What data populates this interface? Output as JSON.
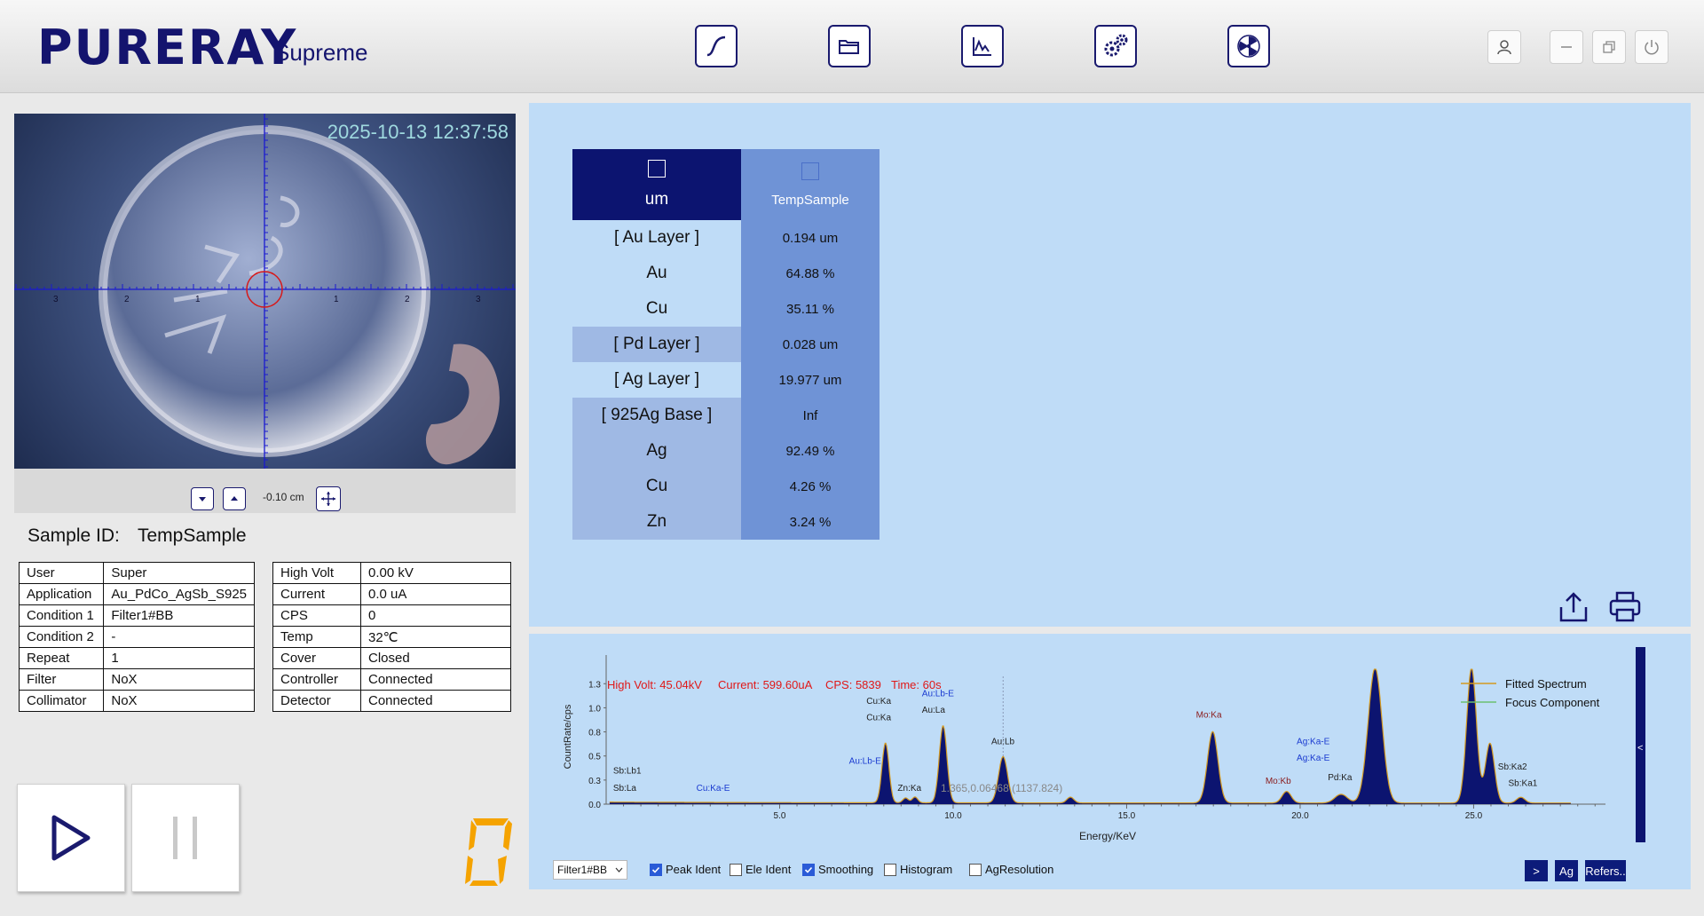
{
  "header": {
    "logo": "PURERAY",
    "logo_sub": "Supreme",
    "toolbar": [
      {
        "name": "curve-tool-button",
        "icon": "curve-icon"
      },
      {
        "name": "open-folder-button",
        "icon": "folder-icon"
      },
      {
        "name": "spectrum-button",
        "icon": "chart-icon"
      },
      {
        "name": "settings-button",
        "icon": "gears-icon"
      },
      {
        "name": "radiation-button",
        "icon": "radiation-icon"
      }
    ]
  },
  "camera": {
    "timestamp": "2025-10-13 12:37:58",
    "scale": "-0.10 cm",
    "ruler_labels": [
      "3",
      "2",
      "1",
      "1",
      "2",
      "3"
    ]
  },
  "sample": {
    "label": "Sample ID:",
    "value": "TempSample"
  },
  "info_left": [
    [
      "User",
      "Super"
    ],
    [
      "Application",
      "Au_PdCo_AgSb_S925"
    ],
    [
      "Condition 1",
      "Filter1#BB"
    ],
    [
      "Condition 2",
      "-"
    ],
    [
      "Repeat",
      "1"
    ],
    [
      "Filter",
      "NoX"
    ],
    [
      "Collimator",
      "NoX"
    ]
  ],
  "info_right": [
    [
      "High Volt",
      "0.00 kV"
    ],
    [
      "Current",
      "0.0 uA"
    ],
    [
      "CPS",
      "0"
    ],
    [
      "Temp",
      "32℃"
    ],
    [
      "Cover",
      "Closed"
    ],
    [
      "Controller",
      "Connected"
    ],
    [
      "Detector",
      "Connected"
    ]
  ],
  "counter_digit": "0",
  "results": {
    "unit_header": "um",
    "sample_header": "TempSample",
    "rows": [
      [
        "[ Au Layer ]",
        "0.194 um"
      ],
      [
        "Au",
        "64.88 %"
      ],
      [
        "Cu",
        "35.11 %"
      ],
      [
        "[ Pd Layer ]",
        "0.028 um"
      ],
      [
        "[ Ag Layer ]",
        "19.977 um"
      ],
      [
        "[ 925Ag Base ]",
        "Inf"
      ],
      [
        "Ag",
        "92.49 %"
      ],
      [
        "Cu",
        "4.26 %"
      ],
      [
        "Zn",
        "3.24 %"
      ]
    ]
  },
  "spectrum": {
    "status": {
      "high_volt": "High Volt: 45.04kV",
      "current": "Current: 599.60uA",
      "cps": "CPS: 5839",
      "time": "Time: 60s"
    },
    "cursor_readout": "1.365,0.06468 (1137.824)",
    "legend": [
      "Fitted Spectrum",
      "Focus Component"
    ],
    "filter_select": "Filter1#BB",
    "options": [
      {
        "label": "Peak Ident",
        "checked": true
      },
      {
        "label": "Ele Ident",
        "checked": false
      },
      {
        "label": "Smoothing",
        "checked": true
      },
      {
        "label": "Histogram",
        "checked": false
      },
      {
        "label": "AgResolution",
        "checked": false
      }
    ],
    "buttons": [
      ">",
      "Ag",
      "Refers.."
    ],
    "side_tab": "<"
  },
  "chart_data": {
    "type": "line",
    "xlabel": "Energy/KeV",
    "ylabel": "CountRate/cps",
    "xlim": [
      0,
      28.8
    ],
    "ylim": [
      0,
      1.4
    ],
    "xticks": [
      "5.0",
      "10.0",
      "15.0",
      "20.0",
      "25.0"
    ],
    "xtick_values": [
      5,
      10,
      15,
      20,
      25
    ],
    "yticks": [
      "0.0",
      "0.3",
      "0.5",
      "0.8",
      "1.0",
      "1.3"
    ],
    "ytick_values": [
      0.0,
      0.25,
      0.5,
      0.75,
      1.0,
      1.25
    ],
    "peaks": [
      {
        "x": 8.05,
        "h": 0.62,
        "w": 0.1
      },
      {
        "x": 8.63,
        "h": 0.05,
        "w": 0.08
      },
      {
        "x": 8.9,
        "h": 0.06,
        "w": 0.08
      },
      {
        "x": 9.71,
        "h": 0.8,
        "w": 0.11
      },
      {
        "x": 11.44,
        "h": 0.48,
        "w": 0.13
      },
      {
        "x": 13.38,
        "h": 0.06,
        "w": 0.1
      },
      {
        "x": 17.48,
        "h": 0.74,
        "w": 0.15
      },
      {
        "x": 19.61,
        "h": 0.12,
        "w": 0.13
      },
      {
        "x": 21.18,
        "h": 0.09,
        "w": 0.18
      },
      {
        "x": 22.16,
        "h": 1.4,
        "w": 0.2
      },
      {
        "x": 24.94,
        "h": 1.4,
        "w": 0.14
      },
      {
        "x": 25.47,
        "h": 0.62,
        "w": 0.13
      },
      {
        "x": 26.36,
        "h": 0.06,
        "w": 0.12
      }
    ],
    "annotations": [
      {
        "text": "Sb:Lb1",
        "x": 0.2,
        "y": 0.32,
        "color": "#222"
      },
      {
        "text": "Sb:La",
        "x": 0.2,
        "y": 0.14,
        "color": "#222"
      },
      {
        "text": "Cu:Ka-E",
        "x": 2.6,
        "y": 0.14,
        "color": "#1a3ad0"
      },
      {
        "text": "Cu:Ka",
        "x": 7.5,
        "y": 1.04,
        "color": "#222"
      },
      {
        "text": "Cu:Ka",
        "x": 7.5,
        "y": 0.87,
        "color": "#222"
      },
      {
        "text": "Au:Lb-E",
        "x": 9.1,
        "y": 1.12,
        "color": "#1a3ad0"
      },
      {
        "text": "Au:La",
        "x": 9.1,
        "y": 0.95,
        "color": "#222"
      },
      {
        "text": "Au:Lb-E",
        "x": 7.0,
        "y": 0.42,
        "color": "#1a3ad0"
      },
      {
        "text": "Zn:Ka",
        "x": 8.4,
        "y": 0.14,
        "color": "#222"
      },
      {
        "text": "Au:Lb",
        "x": 11.1,
        "y": 0.62,
        "color": "#222"
      },
      {
        "text": "Mo:Ka",
        "x": 17.0,
        "y": 0.9,
        "color": "#8a1a1a"
      },
      {
        "text": "Mo:Kb",
        "x": 19.0,
        "y": 0.21,
        "color": "#8a1a1a"
      },
      {
        "text": "Ag:Ka-E",
        "x": 19.9,
        "y": 0.62,
        "color": "#1a3ad0"
      },
      {
        "text": "Ag:Ka-E",
        "x": 19.9,
        "y": 0.45,
        "color": "#1a3ad0"
      },
      {
        "text": "Pd:Ka",
        "x": 20.8,
        "y": 0.25,
        "color": "#222"
      },
      {
        "text": "Sb:Ka2",
        "x": 25.7,
        "y": 0.36,
        "color": "#222"
      },
      {
        "text": "Sb:Ka1",
        "x": 26.0,
        "y": 0.19,
        "color": "#222"
      }
    ]
  }
}
